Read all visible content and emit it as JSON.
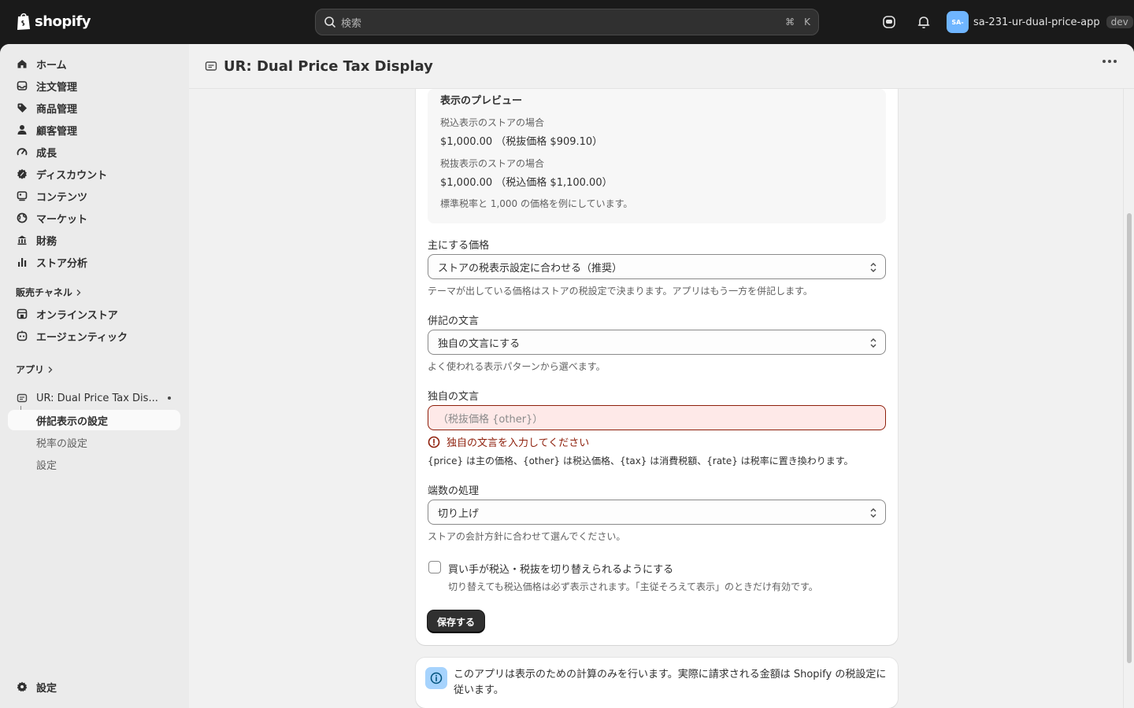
{
  "topbar": {
    "brand": "shopify",
    "search_placeholder": "検索",
    "shortcut_cmd": "⌘",
    "shortcut_key": "K",
    "avatar_initials": "SA-",
    "store_name": "sa-231-ur-dual-price-app",
    "env_badge": "dev"
  },
  "sidebar": {
    "items": [
      {
        "label": "ホーム",
        "icon": "home-icon"
      },
      {
        "label": "注文管理",
        "icon": "inbox-icon"
      },
      {
        "label": "商品管理",
        "icon": "tag-icon"
      },
      {
        "label": "顧客管理",
        "icon": "person-icon"
      },
      {
        "label": "成長",
        "icon": "gauge-icon"
      },
      {
        "label": "ディスカウント",
        "icon": "discount-icon"
      },
      {
        "label": "コンテンツ",
        "icon": "content-icon"
      },
      {
        "label": "マーケット",
        "icon": "globe-icon"
      },
      {
        "label": "財務",
        "icon": "bank-icon"
      },
      {
        "label": "ストア分析",
        "icon": "chart-icon"
      }
    ],
    "sales_channels_title": "販売チャネル",
    "channels": [
      {
        "label": "オンラインストア",
        "icon": "store-icon"
      },
      {
        "label": "エージェンティック",
        "icon": "agentic-icon"
      }
    ],
    "apps_title": "アプリ",
    "app_name": "UR: Dual Price Tax Dis...",
    "app_subitems": [
      "併記表示の設定",
      "税率の設定",
      "設定"
    ],
    "settings_label": "設定"
  },
  "header": {
    "title": "UR: Dual Price Tax Display"
  },
  "preview": {
    "title": "表示のプレビュー",
    "incl_label": "税込表示のストアの場合",
    "incl_value": "$1,000.00 （税抜価格 $909.10）",
    "excl_label": "税抜表示のストアの場合",
    "excl_value": "$1,000.00 （税込価格 $1,100.00）",
    "note": "標準税率と 1,000 の価格を例にしています。"
  },
  "form": {
    "main_price_label": "主にする価格",
    "main_price_value": "ストアの税表示設定に合わせる（推奨）",
    "main_price_help": "テーマが出している価格はストアの税設定で決まります。アプリはもう一方を併記します。",
    "wording_label": "併記の文言",
    "wording_value": "独自の文言にする",
    "wording_help": "よく使われる表示パターンから選べます。",
    "custom_label": "独自の文言",
    "custom_placeholder": "（税抜価格 {other}）",
    "custom_error": "独自の文言を入力してください",
    "custom_help": "{price} は主の価格、{other} は税込価格、{tax} は消費税額、{rate} は税率に置き換わります。",
    "rounding_label": "端数の処理",
    "rounding_value": "切り上げ",
    "rounding_help": "ストアの会計方針に合わせて選んでください。",
    "toggle_label": "買い手が税込・税抜を切り替えられるようにする",
    "toggle_help": "切り替えても税込価格は必ず表示されます。「主従そろえて表示」のときだけ有効です。",
    "save_label": "保存する"
  },
  "info": {
    "text": "このアプリは表示のための計算のみを行います。実際に請求される金額は Shopify の税設定に従います。"
  },
  "colors": {
    "topbar": "#1a1a1a",
    "error": "#8e1f0b",
    "error_bg": "#fee9e8",
    "info_icon_bg": "#a6d3fd",
    "avatar": "#6fb5ff"
  }
}
